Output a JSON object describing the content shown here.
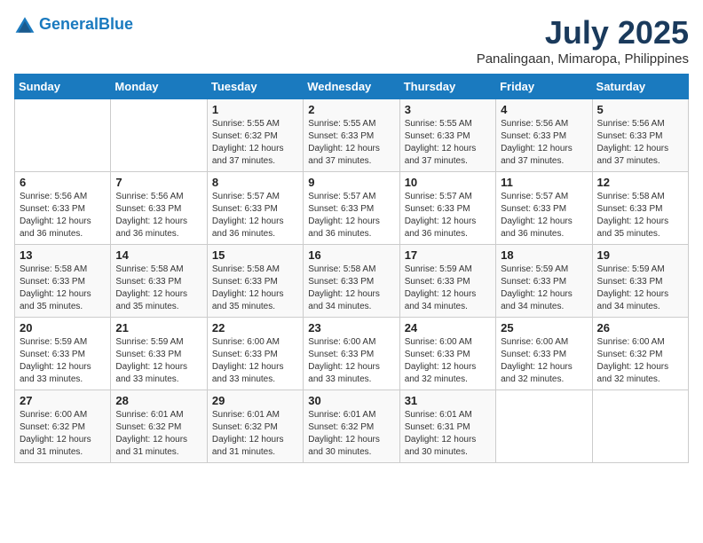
{
  "logo": {
    "line1": "General",
    "line2": "Blue"
  },
  "title": "July 2025",
  "subtitle": "Panalingaan, Mimaropa, Philippines",
  "days_of_week": [
    "Sunday",
    "Monday",
    "Tuesday",
    "Wednesday",
    "Thursday",
    "Friday",
    "Saturday"
  ],
  "weeks": [
    [
      {
        "day": "",
        "sunrise": "",
        "sunset": "",
        "daylight": ""
      },
      {
        "day": "",
        "sunrise": "",
        "sunset": "",
        "daylight": ""
      },
      {
        "day": "1",
        "sunrise": "Sunrise: 5:55 AM",
        "sunset": "Sunset: 6:32 PM",
        "daylight": "Daylight: 12 hours and 37 minutes."
      },
      {
        "day": "2",
        "sunrise": "Sunrise: 5:55 AM",
        "sunset": "Sunset: 6:33 PM",
        "daylight": "Daylight: 12 hours and 37 minutes."
      },
      {
        "day": "3",
        "sunrise": "Sunrise: 5:55 AM",
        "sunset": "Sunset: 6:33 PM",
        "daylight": "Daylight: 12 hours and 37 minutes."
      },
      {
        "day": "4",
        "sunrise": "Sunrise: 5:56 AM",
        "sunset": "Sunset: 6:33 PM",
        "daylight": "Daylight: 12 hours and 37 minutes."
      },
      {
        "day": "5",
        "sunrise": "Sunrise: 5:56 AM",
        "sunset": "Sunset: 6:33 PM",
        "daylight": "Daylight: 12 hours and 37 minutes."
      }
    ],
    [
      {
        "day": "6",
        "sunrise": "Sunrise: 5:56 AM",
        "sunset": "Sunset: 6:33 PM",
        "daylight": "Daylight: 12 hours and 36 minutes."
      },
      {
        "day": "7",
        "sunrise": "Sunrise: 5:56 AM",
        "sunset": "Sunset: 6:33 PM",
        "daylight": "Daylight: 12 hours and 36 minutes."
      },
      {
        "day": "8",
        "sunrise": "Sunrise: 5:57 AM",
        "sunset": "Sunset: 6:33 PM",
        "daylight": "Daylight: 12 hours and 36 minutes."
      },
      {
        "day": "9",
        "sunrise": "Sunrise: 5:57 AM",
        "sunset": "Sunset: 6:33 PM",
        "daylight": "Daylight: 12 hours and 36 minutes."
      },
      {
        "day": "10",
        "sunrise": "Sunrise: 5:57 AM",
        "sunset": "Sunset: 6:33 PM",
        "daylight": "Daylight: 12 hours and 36 minutes."
      },
      {
        "day": "11",
        "sunrise": "Sunrise: 5:57 AM",
        "sunset": "Sunset: 6:33 PM",
        "daylight": "Daylight: 12 hours and 36 minutes."
      },
      {
        "day": "12",
        "sunrise": "Sunrise: 5:58 AM",
        "sunset": "Sunset: 6:33 PM",
        "daylight": "Daylight: 12 hours and 35 minutes."
      }
    ],
    [
      {
        "day": "13",
        "sunrise": "Sunrise: 5:58 AM",
        "sunset": "Sunset: 6:33 PM",
        "daylight": "Daylight: 12 hours and 35 minutes."
      },
      {
        "day": "14",
        "sunrise": "Sunrise: 5:58 AM",
        "sunset": "Sunset: 6:33 PM",
        "daylight": "Daylight: 12 hours and 35 minutes."
      },
      {
        "day": "15",
        "sunrise": "Sunrise: 5:58 AM",
        "sunset": "Sunset: 6:33 PM",
        "daylight": "Daylight: 12 hours and 35 minutes."
      },
      {
        "day": "16",
        "sunrise": "Sunrise: 5:58 AM",
        "sunset": "Sunset: 6:33 PM",
        "daylight": "Daylight: 12 hours and 34 minutes."
      },
      {
        "day": "17",
        "sunrise": "Sunrise: 5:59 AM",
        "sunset": "Sunset: 6:33 PM",
        "daylight": "Daylight: 12 hours and 34 minutes."
      },
      {
        "day": "18",
        "sunrise": "Sunrise: 5:59 AM",
        "sunset": "Sunset: 6:33 PM",
        "daylight": "Daylight: 12 hours and 34 minutes."
      },
      {
        "day": "19",
        "sunrise": "Sunrise: 5:59 AM",
        "sunset": "Sunset: 6:33 PM",
        "daylight": "Daylight: 12 hours and 34 minutes."
      }
    ],
    [
      {
        "day": "20",
        "sunrise": "Sunrise: 5:59 AM",
        "sunset": "Sunset: 6:33 PM",
        "daylight": "Daylight: 12 hours and 33 minutes."
      },
      {
        "day": "21",
        "sunrise": "Sunrise: 5:59 AM",
        "sunset": "Sunset: 6:33 PM",
        "daylight": "Daylight: 12 hours and 33 minutes."
      },
      {
        "day": "22",
        "sunrise": "Sunrise: 6:00 AM",
        "sunset": "Sunset: 6:33 PM",
        "daylight": "Daylight: 12 hours and 33 minutes."
      },
      {
        "day": "23",
        "sunrise": "Sunrise: 6:00 AM",
        "sunset": "Sunset: 6:33 PM",
        "daylight": "Daylight: 12 hours and 33 minutes."
      },
      {
        "day": "24",
        "sunrise": "Sunrise: 6:00 AM",
        "sunset": "Sunset: 6:33 PM",
        "daylight": "Daylight: 12 hours and 32 minutes."
      },
      {
        "day": "25",
        "sunrise": "Sunrise: 6:00 AM",
        "sunset": "Sunset: 6:33 PM",
        "daylight": "Daylight: 12 hours and 32 minutes."
      },
      {
        "day": "26",
        "sunrise": "Sunrise: 6:00 AM",
        "sunset": "Sunset: 6:32 PM",
        "daylight": "Daylight: 12 hours and 32 minutes."
      }
    ],
    [
      {
        "day": "27",
        "sunrise": "Sunrise: 6:00 AM",
        "sunset": "Sunset: 6:32 PM",
        "daylight": "Daylight: 12 hours and 31 minutes."
      },
      {
        "day": "28",
        "sunrise": "Sunrise: 6:01 AM",
        "sunset": "Sunset: 6:32 PM",
        "daylight": "Daylight: 12 hours and 31 minutes."
      },
      {
        "day": "29",
        "sunrise": "Sunrise: 6:01 AM",
        "sunset": "Sunset: 6:32 PM",
        "daylight": "Daylight: 12 hours and 31 minutes."
      },
      {
        "day": "30",
        "sunrise": "Sunrise: 6:01 AM",
        "sunset": "Sunset: 6:32 PM",
        "daylight": "Daylight: 12 hours and 30 minutes."
      },
      {
        "day": "31",
        "sunrise": "Sunrise: 6:01 AM",
        "sunset": "Sunset: 6:31 PM",
        "daylight": "Daylight: 12 hours and 30 minutes."
      },
      {
        "day": "",
        "sunrise": "",
        "sunset": "",
        "daylight": ""
      },
      {
        "day": "",
        "sunrise": "",
        "sunset": "",
        "daylight": ""
      }
    ]
  ]
}
